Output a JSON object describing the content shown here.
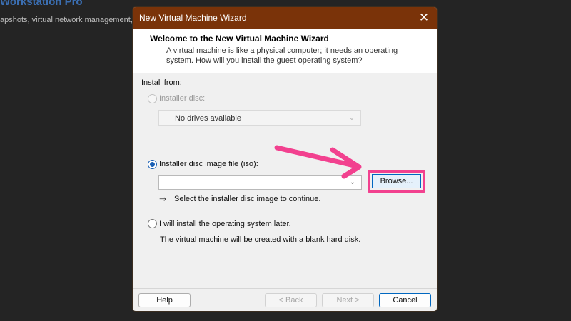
{
  "background": {
    "app_title": "Workstation Pro",
    "subtitle": "apshots, virtual network management,"
  },
  "dialog": {
    "title": "New Virtual Machine Wizard",
    "close_icon": "close-icon",
    "header": {
      "title": "Welcome to the New Virtual Machine Wizard",
      "description": "A virtual machine is like a physical computer; it needs an operating system. How will you install the guest operating system?"
    },
    "install_from_label": "Install from:",
    "option_disc": {
      "label": "Installer disc:",
      "selected": false,
      "enabled": false,
      "dropdown_value": "No drives available"
    },
    "option_iso": {
      "label": "Installer disc image file (iso):",
      "selected": true,
      "enabled": true,
      "input_value": "",
      "browse_label": "Browse...",
      "hint": "Select the installer disc image to continue.",
      "hint_icon": "arrow-right-icon"
    },
    "option_later": {
      "label": "I will install the operating system later.",
      "selected": false,
      "enabled": true,
      "description": "The virtual machine will be created with a blank hard disk."
    },
    "footer": {
      "help": "Help",
      "back": "< Back",
      "next": "Next >",
      "cancel": "Cancel"
    }
  },
  "annotation": {
    "highlight_color": "#f2418f",
    "pointer_icon": "annotation-arrow-icon"
  },
  "colors": {
    "titlebar": "#7a3309",
    "accent": "#0067c0",
    "background": "#242424"
  }
}
